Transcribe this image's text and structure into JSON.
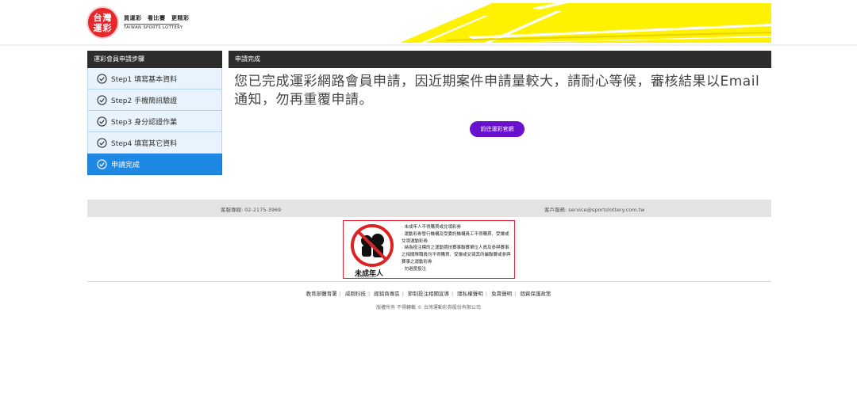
{
  "header": {
    "logo_text": "台灣\n運彩",
    "slogan": "買運彩　看比賽　更精彩",
    "brand_en": "TAIWAN SPORTS LOTTERY",
    "stripe_color": "#fff200"
  },
  "sidebar": {
    "title": "運彩會員申請步驟",
    "steps": [
      {
        "label": "Step1 填寫基本資料",
        "completed": true
      },
      {
        "label": "Step2 手機簡訊驗證",
        "completed": true
      },
      {
        "label": "Step3 身分認證作業",
        "completed": true
      },
      {
        "label": "Step4 填寫其它資料",
        "completed": true
      },
      {
        "label": "申請完成",
        "completed": true,
        "active": true
      }
    ]
  },
  "main": {
    "title": "申請完成",
    "message": "您已完成運彩網路會員申請，因近期案件申請量較大，請耐心等候，審核結果以Email通知，勿再重覆申請。",
    "button_label": "前往運彩官網",
    "button_color": "#6a10cf"
  },
  "contact": {
    "phone": "客服專線: 02-2175-3969",
    "email": "客戶服務: service@sportslottery.com.tw"
  },
  "warning": {
    "title": "未成年人",
    "subtitle": "不得購買或兌領彩券",
    "items": [
      "· 未成年人不得購買或兌領彩券",
      "· 運動彩券發行機構及受委託機構員工不得購買、受讓或兌領運動彩券",
      "· 納為投注標的之運動競技賽事聯賽單位人員及參與賽事之相關隊職員均不得購買、受讓或兌領其所屬聯賽或參與賽事之運動彩券",
      "· 勿過度投注"
    ]
  },
  "footer": {
    "links": [
      "教育部體育署",
      "威剛科技",
      "經銷商專區",
      "節制投注相關宣導",
      "隱私權聲明",
      "免責聲明",
      "個資保護政策"
    ],
    "copyright": "版權所有 不得轉載 © 台灣運動彩券股份有限公司"
  }
}
